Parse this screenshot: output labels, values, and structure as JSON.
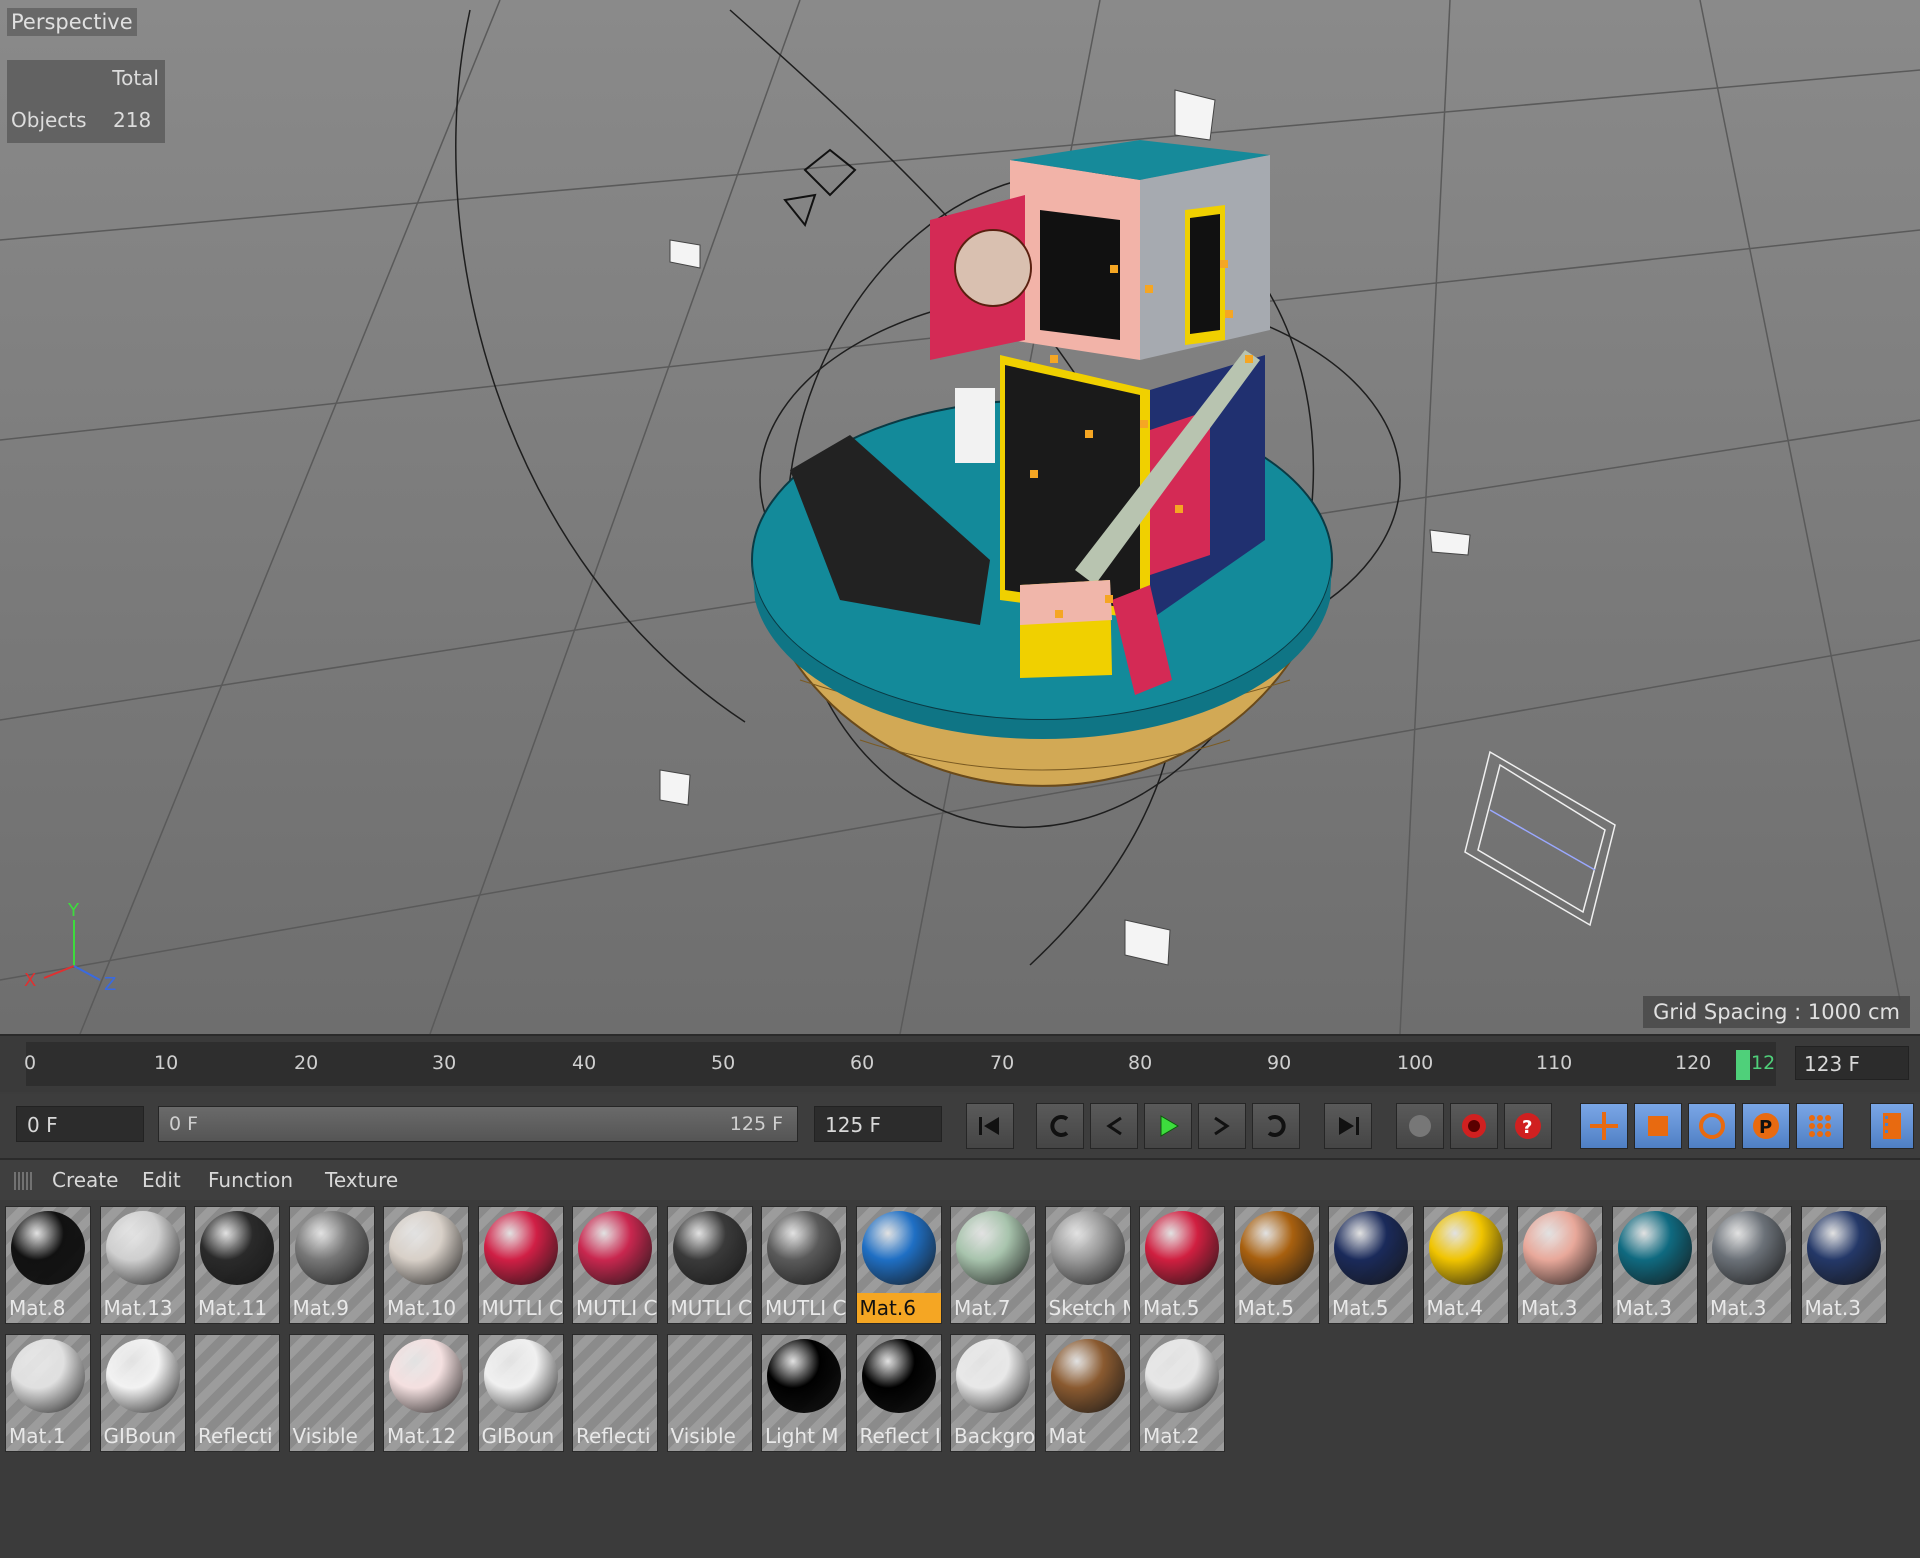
{
  "viewport": {
    "label": "Perspective",
    "stats": {
      "header": "Total",
      "label": "Objects",
      "value": "218"
    },
    "grid_spacing": "Grid Spacing : 1000 cm",
    "axis_labels": {
      "x": "X",
      "y": "Y",
      "z": "Z"
    }
  },
  "timeline": {
    "ticks": [
      "0",
      "10",
      "20",
      "30",
      "40",
      "50",
      "60",
      "70",
      "80",
      "90",
      "100",
      "110",
      "120",
      "12"
    ],
    "current_frame_field": "123 F"
  },
  "transport": {
    "start_field": "0 F",
    "range_start": "0 F",
    "range_end": "125 F",
    "end_field": "125 F"
  },
  "menu": {
    "items": [
      "Create",
      "Edit",
      "Function",
      "Texture"
    ]
  },
  "materials": {
    "row1": [
      {
        "label": "Mat.8",
        "color": "#111111"
      },
      {
        "label": "Mat.13",
        "color": "#cfcfcf"
      },
      {
        "label": "Mat.11",
        "color": "#2a2a2a"
      },
      {
        "label": "Mat.9",
        "color": "#777777"
      },
      {
        "label": "Mat.10",
        "color": "#d8d0c8"
      },
      {
        "label": "MUTLI C",
        "color": "#d01f45"
      },
      {
        "label": "MUTLI C",
        "color": "#c9274f"
      },
      {
        "label": "MUTLI C",
        "color": "#3a3a3a"
      },
      {
        "label": "MUTLI C",
        "color": "#5a5a5a"
      },
      {
        "label": "Mat.6",
        "color": "#1f6fc4"
      },
      {
        "label": "Mat.7",
        "color": "#a8c4ad"
      },
      {
        "label": "Sketch M",
        "color": "#9a9a9a"
      },
      {
        "label": "Mat.5",
        "color": "#d01f40"
      },
      {
        "label": "Mat.5",
        "color": "#a8600f"
      },
      {
        "label": "Mat.5",
        "color": "#1a2a5a"
      },
      {
        "label": "Mat.4",
        "color": "#f0c400"
      },
      {
        "label": "Mat.3",
        "color": "#e8a89a"
      },
      {
        "label": "Mat.3",
        "color": "#0f6a80"
      },
      {
        "label": "Mat.3",
        "color": "#6b7178"
      },
      {
        "label": "Mat.3",
        "color": "#243868"
      }
    ],
    "row2": [
      {
        "label": "Mat.1",
        "color": "#e0e0e0"
      },
      {
        "label": "GIBoun",
        "color": "#f2f2f2"
      },
      {
        "label": "Reflecti",
        "color": ""
      },
      {
        "label": "Visible",
        "color": ""
      },
      {
        "label": "Mat.12",
        "color": "#f4e0e0"
      },
      {
        "label": "GIBoun",
        "color": "#f0f0f0"
      },
      {
        "label": "Reflecti",
        "color": ""
      },
      {
        "label": "Visible",
        "color": ""
      },
      {
        "label": "Light M",
        "color": "#000000"
      },
      {
        "label": "Reflect I",
        "color": "#000000"
      },
      {
        "label": "Backgro",
        "color": "#e8e8e8"
      },
      {
        "label": "Mat",
        "color": "#8a5a30"
      },
      {
        "label": "Mat.2",
        "color": "#e6e6e6"
      }
    ],
    "selected_label": "Mat.6"
  },
  "colors": {
    "accent": "#f5a623",
    "playhead": "#4fd07a",
    "transport_blue": "#5b8bd4"
  }
}
